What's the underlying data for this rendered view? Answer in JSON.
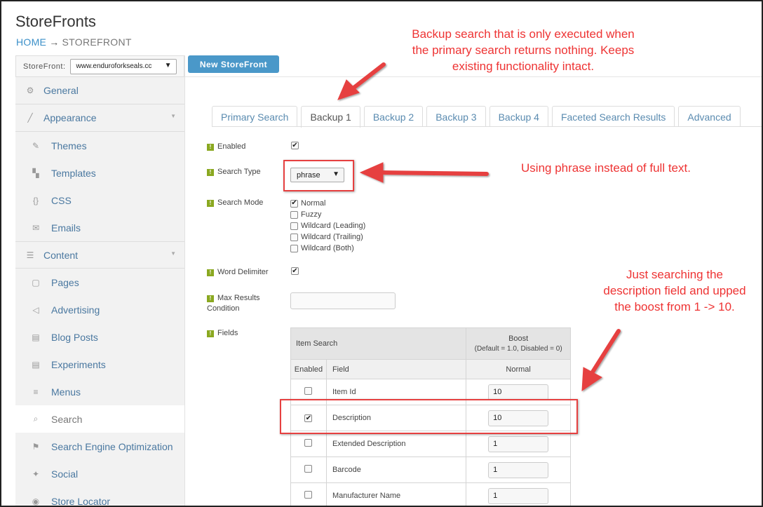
{
  "page": {
    "title": "StoreFronts"
  },
  "breadcrumb": {
    "home": "HOME",
    "separator": "→",
    "current": "STOREFRONT"
  },
  "storefront_selector": {
    "label": "StoreFront:",
    "value": "www.enduroforkseals.cc"
  },
  "new_storefront_button": "New StoreFront",
  "sidebar": {
    "items": [
      {
        "label": "General",
        "icon": "gear-icon",
        "level": "top"
      },
      {
        "label": "Appearance",
        "icon": "brush-icon",
        "level": "top",
        "expandable": true
      },
      {
        "label": "Themes",
        "icon": "paint-icon",
        "level": "sub"
      },
      {
        "label": "Templates",
        "icon": "templates-icon",
        "level": "sub"
      },
      {
        "label": "CSS",
        "icon": "braces-icon",
        "level": "sub"
      },
      {
        "label": "Emails",
        "icon": "envelope-icon",
        "level": "sub"
      },
      {
        "label": "Content",
        "icon": "list-icon",
        "level": "top",
        "expandable": true
      },
      {
        "label": "Pages",
        "icon": "page-icon",
        "level": "sub"
      },
      {
        "label": "Advertising",
        "icon": "megaphone-icon",
        "level": "sub"
      },
      {
        "label": "Blog Posts",
        "icon": "document-icon",
        "level": "sub"
      },
      {
        "label": "Experiments",
        "icon": "document-icon",
        "level": "sub"
      },
      {
        "label": "Menus",
        "icon": "menu-icon",
        "level": "sub"
      },
      {
        "label": "Search",
        "icon": "search-icon",
        "level": "sub",
        "active": true
      },
      {
        "label": "Search Engine Optimization",
        "icon": "flag-icon",
        "level": "sub"
      },
      {
        "label": "Social",
        "icon": "twitter-icon",
        "level": "sub"
      },
      {
        "label": "Store Locator",
        "icon": "location-icon",
        "level": "sub"
      }
    ]
  },
  "tabs": [
    {
      "label": "Primary Search",
      "active": false
    },
    {
      "label": "Backup 1",
      "active": true
    },
    {
      "label": "Backup 2",
      "active": false
    },
    {
      "label": "Backup 3",
      "active": false
    },
    {
      "label": "Backup 4",
      "active": false
    },
    {
      "label": "Faceted Search Results",
      "active": false
    },
    {
      "label": "Advanced",
      "active": false
    }
  ],
  "form": {
    "help_icon": "help-icon",
    "enabled": {
      "label": "Enabled",
      "checked": true
    },
    "search_type": {
      "label": "Search Type",
      "value": "phrase"
    },
    "search_mode": {
      "label": "Search Mode",
      "options": [
        {
          "label": "Normal",
          "checked": true
        },
        {
          "label": "Fuzzy",
          "checked": false
        },
        {
          "label": "Wildcard (Leading)",
          "checked": false
        },
        {
          "label": "Wildcard (Trailing)",
          "checked": false
        },
        {
          "label": "Wildcard (Both)",
          "checked": false
        }
      ]
    },
    "word_delimiter": {
      "label": "Word Delimiter",
      "checked": true
    },
    "max_results": {
      "label_line1": "Max Results",
      "label_line2": "Condition",
      "value": ""
    },
    "fields": {
      "label": "Fields",
      "header_item_search": "Item Search",
      "header_boost": "Boost",
      "header_boost_note": "(Default = 1.0, Disabled = 0)",
      "col_enabled": "Enabled",
      "col_field": "Field",
      "col_normal": "Normal",
      "rows": [
        {
          "field": "Item Id",
          "enabled": false,
          "boost": "10"
        },
        {
          "field": "Description",
          "enabled": true,
          "boost": "10"
        },
        {
          "field": "Extended Description",
          "enabled": false,
          "boost": "1"
        },
        {
          "field": "Barcode",
          "enabled": false,
          "boost": "1"
        },
        {
          "field": "Manufacturer Name",
          "enabled": false,
          "boost": "1"
        }
      ]
    }
  },
  "annotations": {
    "backup": "Backup search that is only executed when the primary search returns nothing.  Keeps existing functionality intact.",
    "phrase": "Using phrase instead of full text.",
    "description": "Just searching the description field and upped the boost from 1 -> 10."
  },
  "colors": {
    "accent": "#4a98c9",
    "link": "#4a78a0",
    "annotation": "#ee3333",
    "help": "#8aa820"
  }
}
